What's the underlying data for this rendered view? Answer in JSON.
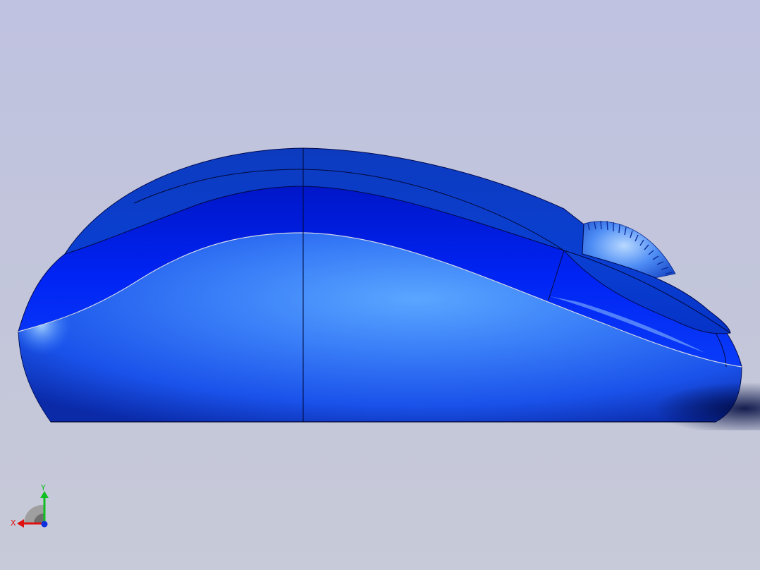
{
  "viewport": {
    "background_top": "#bfc2e0",
    "background_bottom": "#c7cad8",
    "model": {
      "name": "mouse-model",
      "colors": {
        "shell_upper": "#0a34c9",
        "grip_band": "#0022f0",
        "lower_body": "#2a6cf5",
        "highlight": "#8fc2ff",
        "edge": "#00105a"
      }
    }
  },
  "triad": {
    "x_label": "X",
    "y_label": "Y",
    "x_color": "#e01010",
    "y_color": "#10c020",
    "z_color": "#1030e0"
  }
}
